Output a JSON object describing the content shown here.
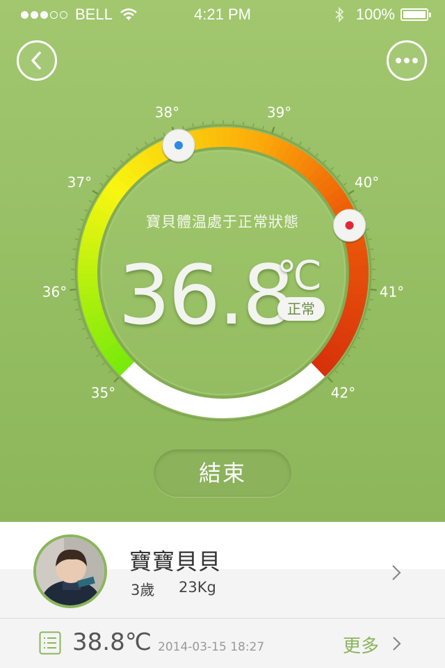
{
  "status_bar": {
    "carrier": "BELL",
    "time": "4:21 PM",
    "battery": "100%"
  },
  "gauge": {
    "status_message": "寶貝體温處于正常狀態",
    "current_temp": "36.8",
    "unit": "℃",
    "status_label": "正常",
    "scale_labels": [
      "35°",
      "36°",
      "37°",
      "38°",
      "39°",
      "40°",
      "41°",
      "42°"
    ],
    "scale_min": 35,
    "scale_max": 42,
    "low_alarm_temp": 38,
    "high_alarm_temp": 40.3,
    "low_handle_color": "#2d8be0",
    "high_handle_color": "#e0283a"
  },
  "end_button_label": "結束",
  "profile": {
    "name": "寶寶貝貝",
    "age": "3歲",
    "weight": "23Kg"
  },
  "last_record": {
    "temp": "38.8℃",
    "time": "2014-03-15 18:27",
    "more_label": "更多"
  },
  "colors": {
    "background_green": "#97bf64",
    "accent_green": "#8ab65a"
  }
}
